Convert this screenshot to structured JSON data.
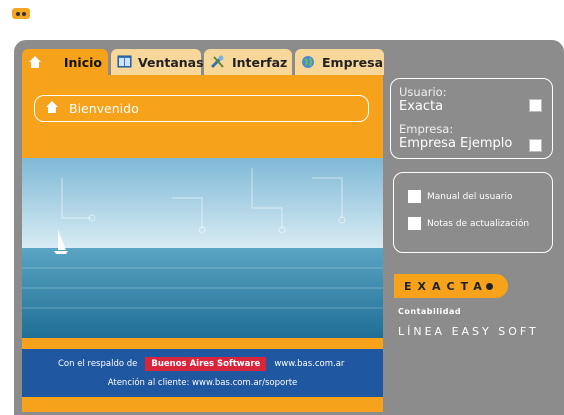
{
  "tabs": [
    {
      "label": "Inicio",
      "icon": "home-icon",
      "active": true
    },
    {
      "label": "Ventanas",
      "icon": "window-icon",
      "active": false
    },
    {
      "label": "Interfaz",
      "icon": "tools-icon",
      "active": false
    },
    {
      "label": "Empresa",
      "icon": "globe-icon",
      "active": false
    }
  ],
  "welcome": {
    "label": "Bienvenido",
    "icon": "home-icon"
  },
  "footer": {
    "support_prefix": "Con el respaldo de",
    "brand": "Buenos Aires Software",
    "url": "www.bas.com.ar",
    "support_line": "Atención al cliente: www.bas.com.ar/soporte"
  },
  "user_panel": {
    "user_label": "Usuario:",
    "user_value": "Exacta",
    "company_label": "Empresa:",
    "company_value": "Empresa Ejemplo"
  },
  "docs": [
    {
      "label": "Manual del usuario"
    },
    {
      "label": "Notas de actualización"
    }
  ],
  "brand": {
    "name": "EXACTA",
    "product": "Contabilidad",
    "line": "LÍNEA EASY SOFT"
  },
  "colors": {
    "accent": "#f6a21a",
    "frame": "#8c8c8c",
    "footer": "#1f57a0",
    "badge": "#d9253b"
  }
}
